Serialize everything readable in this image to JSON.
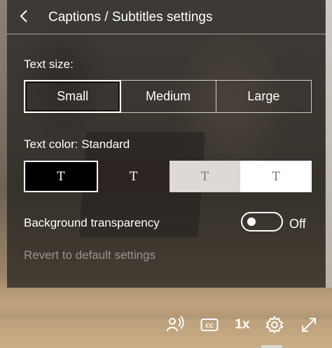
{
  "header": {
    "title": "Captions / Subtitles settings"
  },
  "text_size": {
    "label": "Text size:",
    "options": [
      "Small",
      "Medium",
      "Large"
    ],
    "selected": "Small"
  },
  "text_color": {
    "label": "Text color: Standard",
    "swatch_glyph": "T",
    "swatches": [
      {
        "background": "#000000",
        "text_color": "#ffffff",
        "selected": true
      },
      {
        "background": "#2c2420",
        "text_color": "#ffffff",
        "selected": false
      },
      {
        "background": "#dcd9d6",
        "text_color": "#7a7a7a",
        "selected": false
      },
      {
        "background": "#ffffff",
        "text_color": "#777777",
        "selected": false
      }
    ]
  },
  "background_transparency": {
    "label": "Background transparency",
    "state": "Off",
    "on": false
  },
  "revert": {
    "label": "Revert to default settings"
  },
  "player_controls": {
    "speed_label": "1x",
    "icons": [
      "audio-description-icon",
      "closed-captions-icon",
      "gear-icon",
      "fullscreen-icon"
    ],
    "active_control": "gear-icon"
  }
}
